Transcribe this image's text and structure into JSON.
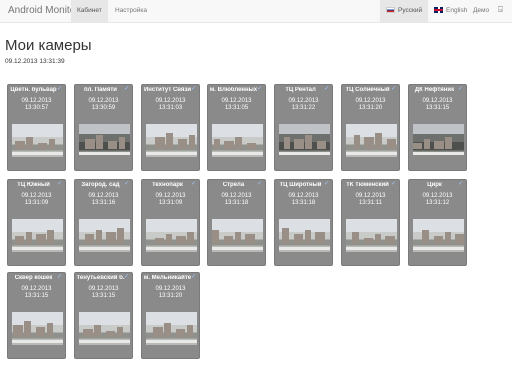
{
  "navbar": {
    "brand": "Android Monitor",
    "items": [
      {
        "label": "Кабинет",
        "active": true
      },
      {
        "label": "Настройка",
        "active": false
      }
    ],
    "languages": [
      {
        "label": "Русский",
        "active": true,
        "flag": "ru-flag-icon"
      },
      {
        "label": "English",
        "active": false,
        "flag": "uk-flag-icon"
      }
    ],
    "demo": "Демо",
    "logout_icon": "logout-icon"
  },
  "page": {
    "title": "Мои камеры",
    "timestamp": "09.12.2013 13:31:39"
  },
  "cameras": [
    {
      "name": "Цветн. бульвар",
      "date": "09.12.2013",
      "time": "13:30:57"
    },
    {
      "name": "пл. Памяти",
      "date": "09.12.2013",
      "time": "13:30:59"
    },
    {
      "name": "Институт Связи",
      "date": "09.12.2013",
      "time": "13:31:03"
    },
    {
      "name": "м. Влюбленных",
      "date": "09.12.2013",
      "time": "13:31:05"
    },
    {
      "name": "ТЦ Рентал",
      "date": "09.12.2013",
      "time": "13:31:22"
    },
    {
      "name": "ТЦ Солнечный",
      "date": "09.12.2013",
      "time": "13:31:20"
    },
    {
      "name": "ДК Нефтяник",
      "date": "09.12.2013",
      "time": "13:31:15"
    },
    {
      "name": "ТЦ Южный",
      "date": "09.12.2013",
      "time": "13:31:09"
    },
    {
      "name": "Загород. сад",
      "date": "09.12.2013",
      "time": "13:31:16"
    },
    {
      "name": "Технопарк",
      "date": "09.12.2013",
      "time": "13:31:09"
    },
    {
      "name": "Стрела",
      "date": "09.12.2013",
      "time": "13:31:18"
    },
    {
      "name": "ТЦ Широтный",
      "date": "09.12.2013",
      "time": "13:31:18"
    },
    {
      "name": "ТК Тюменский",
      "date": "09.12.2013",
      "time": "13:31:11"
    },
    {
      "name": "Цирк",
      "date": "09.12.2013",
      "time": "13:31:12"
    },
    {
      "name": "Сквер кошек",
      "date": "09.12.2013",
      "time": "13:31:15"
    },
    {
      "name": "Тенутьевский б.",
      "date": "09.12.2013",
      "time": "13:31:15"
    },
    {
      "name": "м. Мельникайте",
      "date": "09.12.2013",
      "time": "13:31:20"
    }
  ],
  "colors": {
    "card": "#8a8a8a",
    "navbar": "#f8f8f8"
  }
}
